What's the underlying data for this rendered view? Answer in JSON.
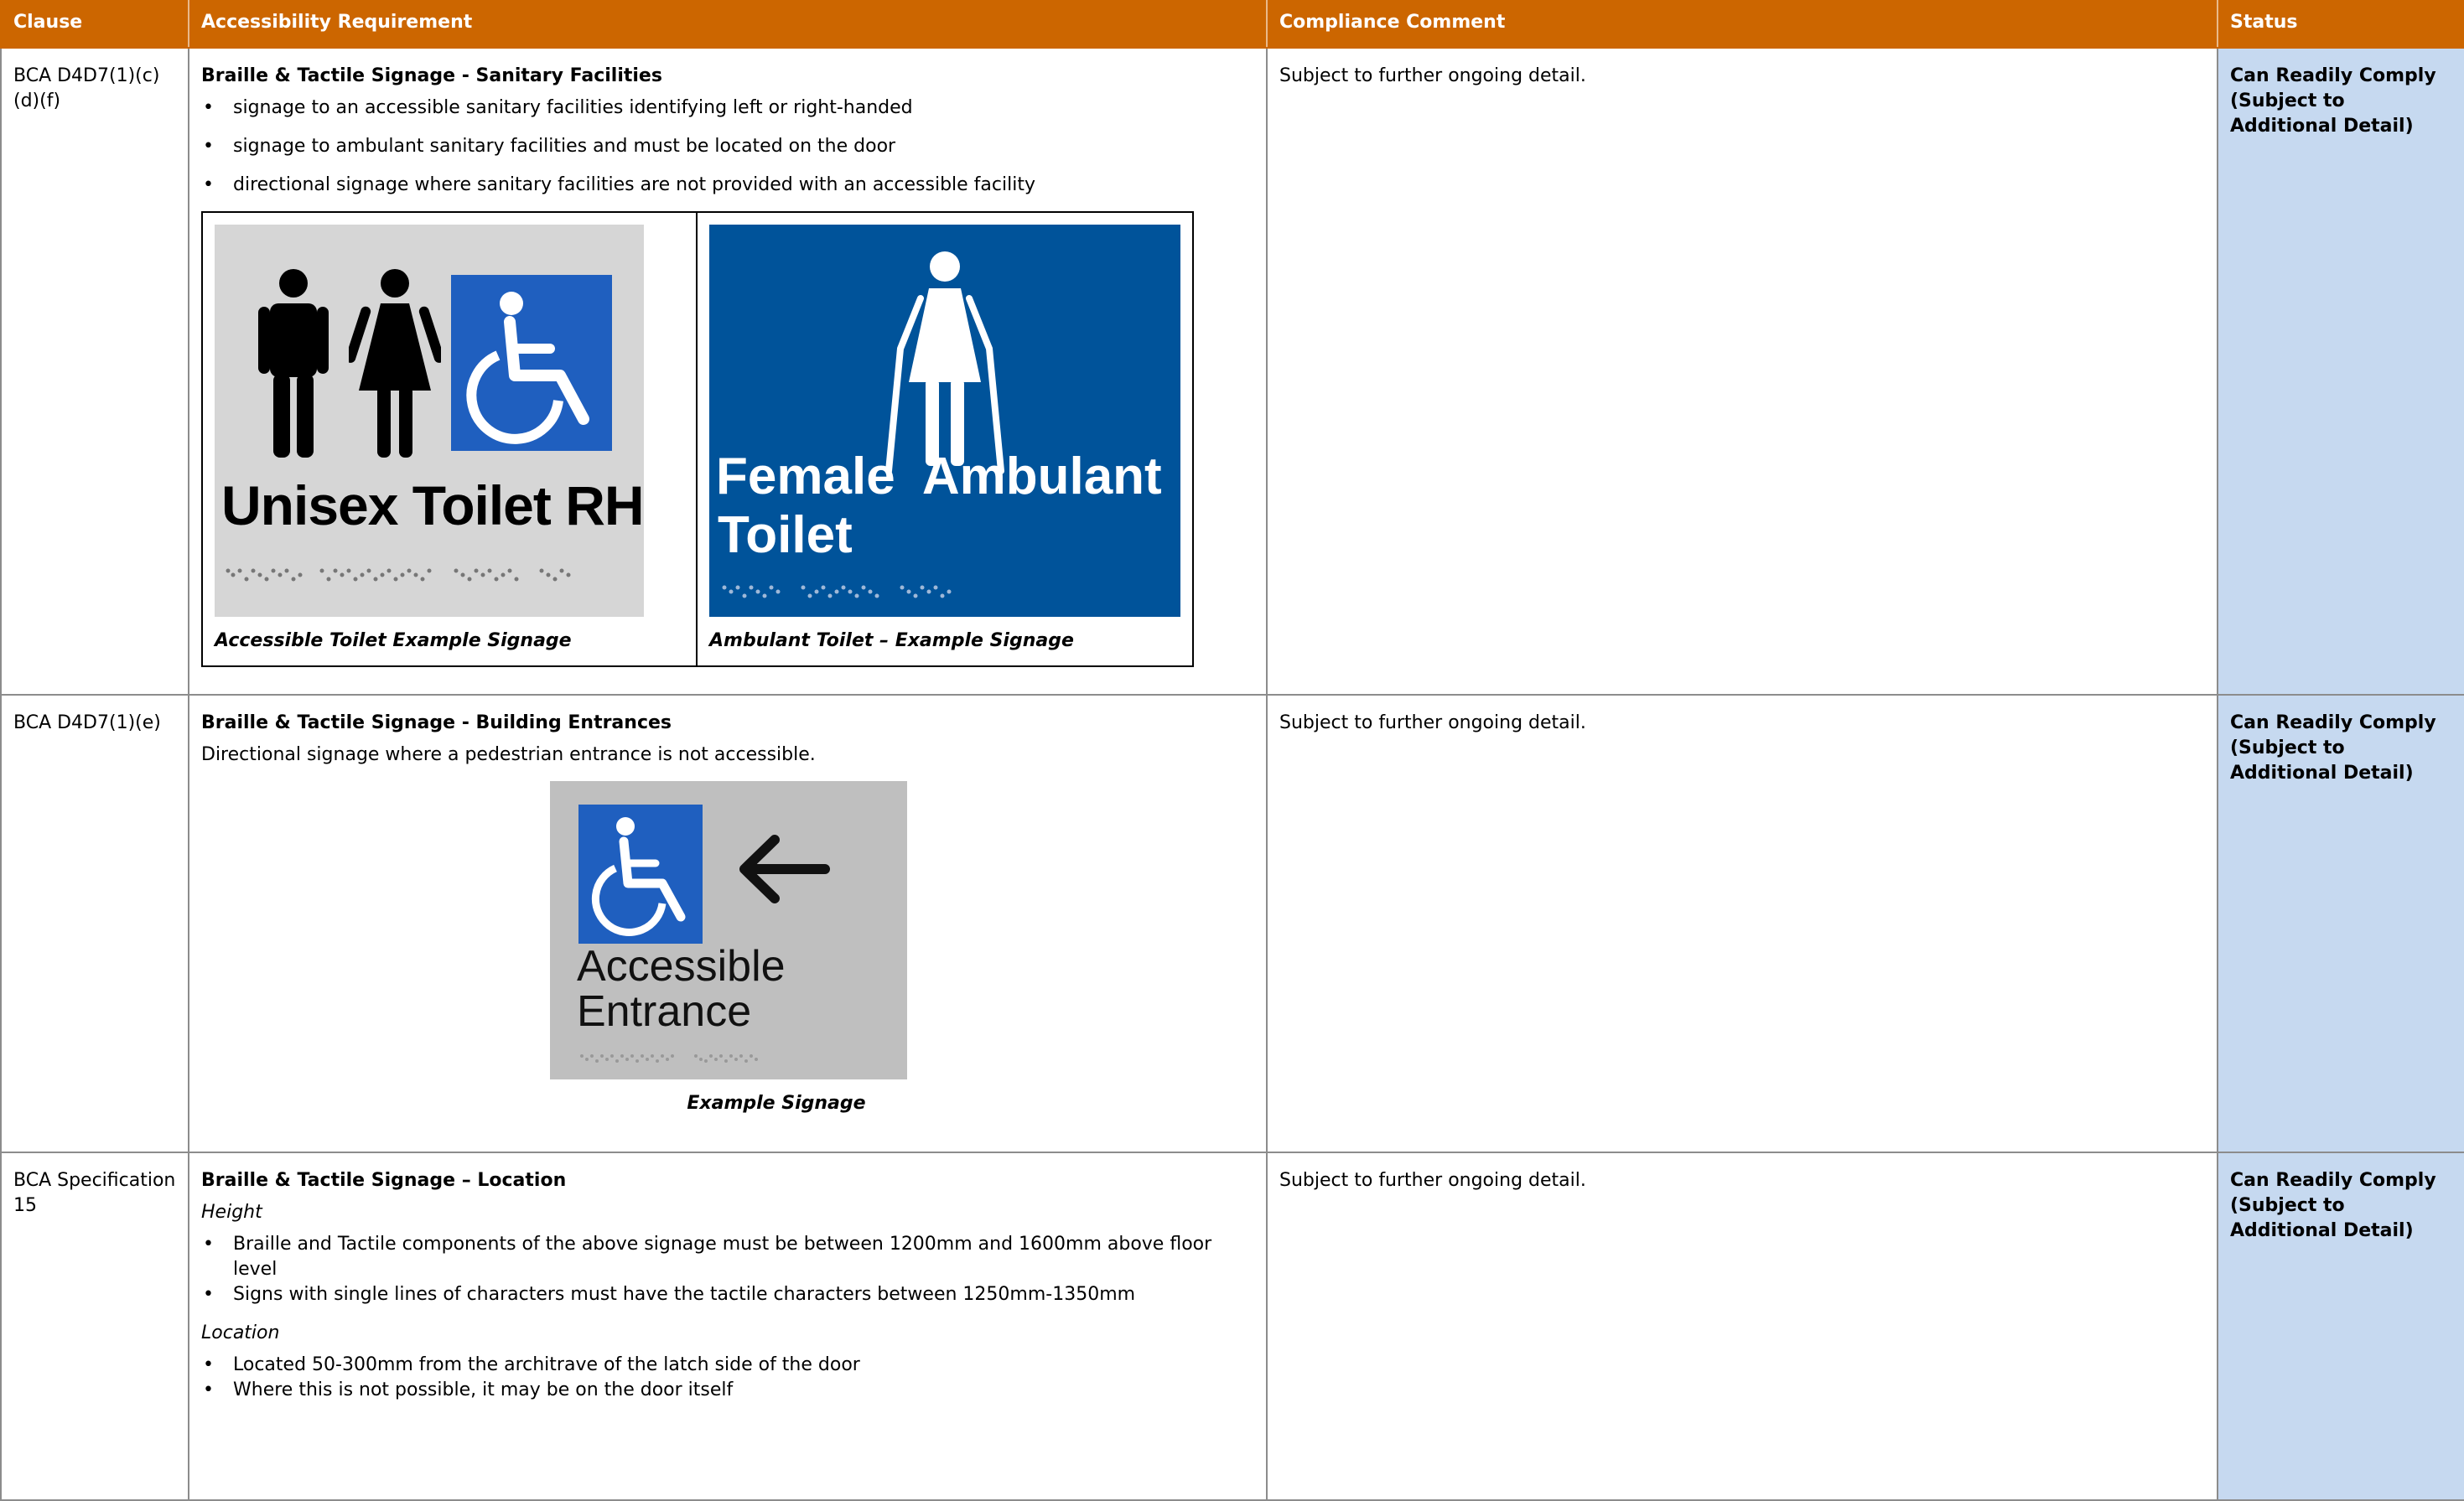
{
  "header": {
    "clause": "Clause",
    "requirement": "Accessibility Requirement",
    "comment": "Compliance Comment",
    "status": "Status"
  },
  "rows": [
    {
      "clause": "BCA D4D7(1)(c)(d)(f)",
      "title": "Braille & Tactile Signage - Sanitary Facilities",
      "bullets": [
        "signage to an accessible sanitary facilities identifying left or right-handed",
        "signage to ambulant sanitary facilities and must be located on the door",
        "directional signage where sanitary facilities are not provided with an accessible facility"
      ],
      "images": [
        {
          "sign_text": "Unisex Toilet RH",
          "caption": "Accessible Toilet Example Signage"
        },
        {
          "sign_text_1": "Female  Ambulant",
          "sign_text_2": "Toilet",
          "caption": "Ambulant Toilet – Example Signage"
        }
      ],
      "comment": "Subject to further ongoing detail.",
      "status": "Can Readily Comply (Subject to Additional Detail)"
    },
    {
      "clause": "BCA D4D7(1)(e)",
      "title": "Braille & Tactile Signage - Building Entrances",
      "text": "Directional signage where a pedestrian entrance is not accessible.",
      "image": {
        "sign_text_1": "Accessible",
        "sign_text_2": "Entrance",
        "caption": "Example Signage"
      },
      "comment": "Subject to further ongoing detail.",
      "status": "Can Readily Comply (Subject to Additional Detail)"
    },
    {
      "clause": "BCA Specification 15",
      "title": "Braille & Tactile Signage – Location",
      "height_label": "Height",
      "height_bullets": [
        "Braille and Tactile components of the above signage must be between 1200mm and 1600mm above floor level",
        "Signs with single lines of characters must have the tactile characters between 1250mm-1350mm"
      ],
      "location_label": "Location",
      "location_bullets": [
        "Located 50-300mm from the architrave of the latch side of the door",
        "Where this is not possible, it may be on the door itself"
      ],
      "comment": "Subject to further ongoing detail.",
      "status": "Can Readily Comply (Subject to Additional Detail)"
    }
  ],
  "colors": {
    "header_bg": "#cc6600",
    "status_bg": "#c6d9f0",
    "sign_blue": "#00539a",
    "accessible_blue": "#1f5fbf"
  }
}
